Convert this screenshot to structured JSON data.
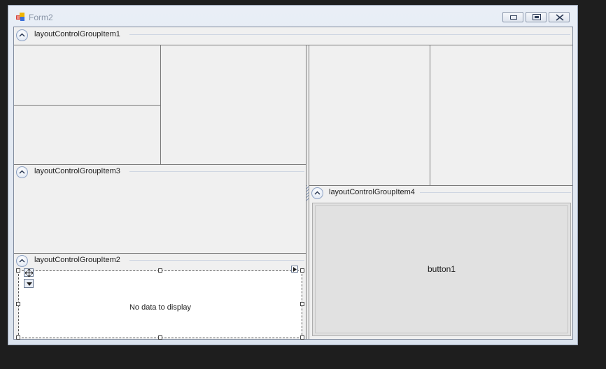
{
  "window": {
    "title": "Form2",
    "minimize_glyph": "▭",
    "maximize_glyph": "▣",
    "close_glyph": "✕"
  },
  "groups": {
    "group1": {
      "title": "layoutControlGroupItem1"
    },
    "group3": {
      "title": "layoutControlGroupItem3"
    },
    "group2": {
      "title": "layoutControlGroupItem2"
    },
    "group4": {
      "title": "layoutControlGroupItem4"
    }
  },
  "grid": {
    "empty_text": "No data to display"
  },
  "button1": {
    "label": "button1"
  },
  "colors": {
    "accent": "#8ea2c3",
    "client_bg": "#f0f0f0",
    "border": "#7a7a7a"
  }
}
